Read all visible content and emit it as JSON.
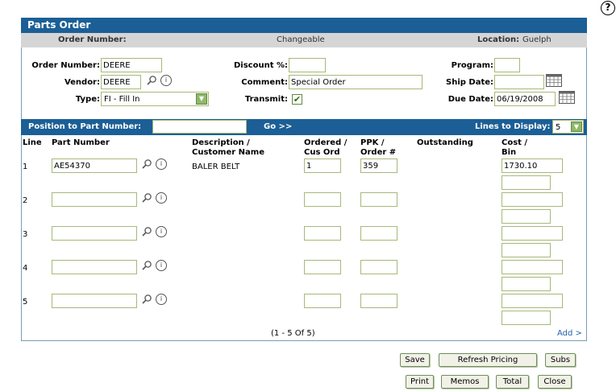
{
  "help": {
    "glyph": "?"
  },
  "header": {
    "title": "Parts Order",
    "order_number_label": "Order Number:",
    "status": "Changeable",
    "location_label": "Location:",
    "location_value": "Guelph"
  },
  "form": {
    "order_number": {
      "label": "Order Number:",
      "value": "DEERE"
    },
    "vendor": {
      "label": "Vendor:",
      "value": "DEERE"
    },
    "type": {
      "label": "Type:",
      "value": "FI - Fill In"
    },
    "discount": {
      "label": "Discount %:",
      "value": ""
    },
    "comment": {
      "label": "Comment:",
      "value": "Special Order"
    },
    "transmit": {
      "label": "Transmit:",
      "checked": "✔"
    },
    "program": {
      "label": "Program:",
      "value": ""
    },
    "ship_date": {
      "label": "Ship Date:",
      "value": ""
    },
    "due_date": {
      "label": "Due Date:",
      "value": "06/19/2008"
    }
  },
  "position_bar": {
    "label": "Position to Part Number:",
    "value": "",
    "go_label": "Go >>",
    "lines_label": "Lines to Display:",
    "lines_value": "5"
  },
  "columns": {
    "line": "Line",
    "part_number": "Part Number",
    "description_1": "Description /",
    "description_2": "Customer Name",
    "ordered_1": "Ordered /",
    "ordered_2": "Cus Ord",
    "ppk_1": "PPK /",
    "ppk_2": "Order #",
    "outstanding": "Outstanding",
    "cost_1": "Cost /",
    "cost_2": "Bin"
  },
  "rows": [
    {
      "line": "1",
      "part": "AE54370",
      "description": "BALER BELT",
      "ordered": "1",
      "ppk": "359",
      "cost": "1730.10",
      "bin": ""
    },
    {
      "line": "2",
      "part": "",
      "description": "",
      "ordered": "",
      "ppk": "",
      "cost": "",
      "bin": ""
    },
    {
      "line": "3",
      "part": "",
      "description": "",
      "ordered": "",
      "ppk": "",
      "cost": "",
      "bin": ""
    },
    {
      "line": "4",
      "part": "",
      "description": "",
      "ordered": "",
      "ppk": "",
      "cost": "",
      "bin": ""
    },
    {
      "line": "5",
      "part": "",
      "description": "",
      "ordered": "",
      "ppk": "",
      "cost": "",
      "bin": ""
    }
  ],
  "pagination": "(1 - 5 Of 5)",
  "add_link": "Add >",
  "buttons": {
    "save": "Save",
    "refresh_pricing": "Refresh Pricing",
    "subs": "Subs",
    "print": "Print",
    "memos": "Memos",
    "total": "Total",
    "close": "Close"
  }
}
